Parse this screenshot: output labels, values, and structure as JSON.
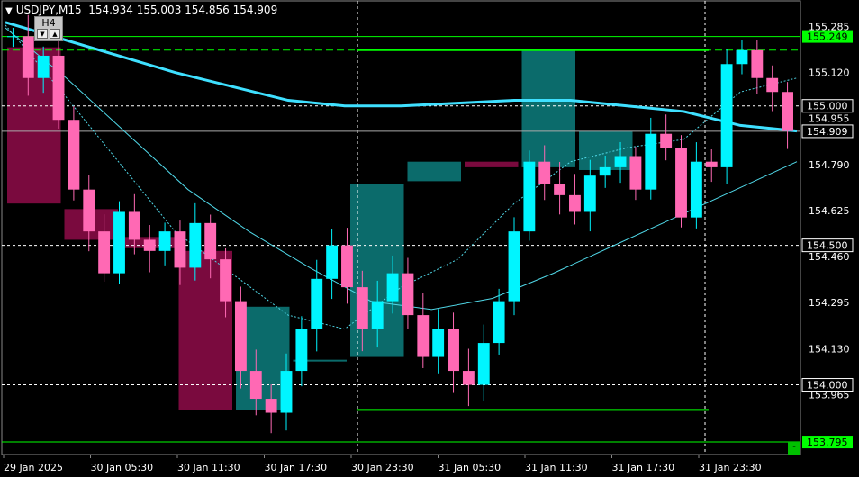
{
  "header": {
    "symbol_tf": "USDJPY,M15",
    "ohlc": "154.934 155.003 154.856 154.909",
    "arrow": "▼"
  },
  "tf_box": {
    "label": "H4",
    "down": "▼",
    "up": "▲"
  },
  "price_axis": {
    "ticks": [
      "155.285",
      "155.120",
      "154.955",
      "154.790",
      "154.625",
      "154.460",
      "154.295",
      "154.130",
      "153.965"
    ],
    "tick_values": [
      155.285,
      155.12,
      154.955,
      154.79,
      154.625,
      154.46,
      154.295,
      154.13,
      153.965
    ],
    "min": 153.75,
    "max": 155.38
  },
  "price_tags": [
    {
      "label": "155.249",
      "value": 155.249,
      "style": "green"
    },
    {
      "label": "155.000",
      "value": 155.0,
      "style": "white"
    },
    {
      "label": "154.909",
      "value": 154.909,
      "style": "white"
    },
    {
      "label": "154.500",
      "value": 154.5,
      "style": "white"
    },
    {
      "label": "154.000",
      "value": 154.0,
      "style": "white"
    },
    {
      "label": "153.795",
      "value": 153.795,
      "style": "green"
    }
  ],
  "time_axis": {
    "labels": [
      "29 Jan 2025",
      "30 Jan 05:30",
      "30 Jan 11:30",
      "30 Jan 17:30",
      "30 Jan 23:30",
      "31 Jan 05:30",
      "31 Jan 11:30",
      "31 Jan 17:30",
      "31 Jan 23:30"
    ]
  },
  "colors": {
    "bull": "#00f5ff",
    "bear": "#ff69b4",
    "h4_bull": "#0b6b6b",
    "h4_bear": "#7a0a3e",
    "ma_slow": "#3fe0ff",
    "ma_fast": "#50d8e8",
    "level_green": "#00ff00",
    "grid": "#ffffff"
  },
  "chart_data": {
    "type": "candlestick",
    "symbol": "USDJPY",
    "timeframe": "M15",
    "x_labels": [
      "29 Jan 2025",
      "30 Jan 05:30",
      "30 Jan 11:30",
      "30 Jan 17:30",
      "30 Jan 23:30",
      "31 Jan 05:30",
      "31 Jan 11:30",
      "31 Jan 17:30",
      "31 Jan 23:30"
    ],
    "ylim": [
      153.75,
      155.38
    ],
    "h4_bars": [
      {
        "o": 155.21,
        "c": 154.65,
        "dir": "bear"
      },
      {
        "o": 154.63,
        "c": 154.52,
        "dir": "bear"
      },
      {
        "o": 154.53,
        "c": 154.49,
        "dir": "bear"
      },
      {
        "o": 154.48,
        "c": 153.91,
        "dir": "bear"
      },
      {
        "o": 153.91,
        "c": 154.28,
        "dir": "bull"
      },
      {
        "o": 154.09,
        "c": 154.09,
        "dir": "bull"
      },
      {
        "o": 154.1,
        "c": 154.72,
        "dir": "bull"
      },
      {
        "o": 154.73,
        "c": 154.8,
        "dir": "bull"
      },
      {
        "o": 154.8,
        "c": 154.78,
        "dir": "bear"
      },
      {
        "o": 154.78,
        "c": 155.2,
        "dir": "bull"
      },
      {
        "o": 154.91,
        "c": 154.77,
        "dir": "bull"
      }
    ],
    "levels": [
      155.249,
      155.2,
      155.0,
      154.909,
      154.5,
      154.0,
      153.91,
      153.795
    ],
    "close_path": [
      155.25,
      155.1,
      155.18,
      154.95,
      154.7,
      154.55,
      154.4,
      154.62,
      154.52,
      154.48,
      154.55,
      154.42,
      154.58,
      154.45,
      154.3,
      154.05,
      153.95,
      153.9,
      154.05,
      154.2,
      154.38,
      154.5,
      154.35,
      154.2,
      154.3,
      154.4,
      154.25,
      154.1,
      154.2,
      154.05,
      154.0,
      154.15,
      154.3,
      154.55,
      154.8,
      154.72,
      154.68,
      154.62,
      154.75,
      154.78,
      154.82,
      154.7,
      154.9,
      154.85,
      154.6,
      154.8,
      154.78,
      155.15,
      155.2,
      155.1,
      155.05,
      154.91
    ]
  }
}
